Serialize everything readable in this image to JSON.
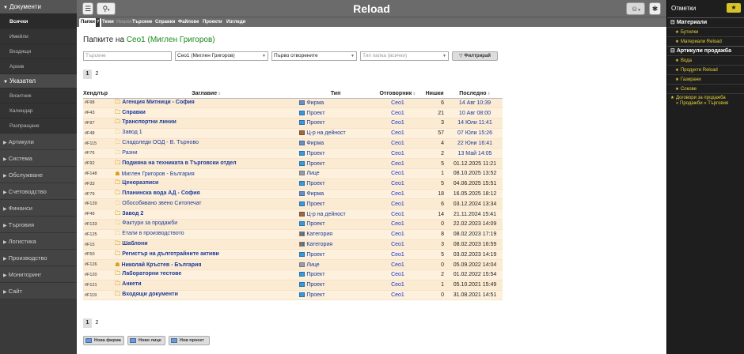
{
  "sidebar": {
    "section_docs": "Документи",
    "docs_items": [
      "Всички",
      "Имейли",
      "Входящи",
      "Архив"
    ],
    "section_index": "Указател",
    "index_items": [
      "Визитник",
      "Календар",
      "Разпращане"
    ],
    "groups": [
      "Артикули",
      "Система",
      "Обслужване",
      "Счетоводство",
      "Финанси",
      "Търговия",
      "Логистика",
      "Производство",
      "Мониторинг",
      "Сайт"
    ]
  },
  "topbar": {
    "title": "Reload"
  },
  "tabs": [
    "Папки",
    "Теми",
    "Нишки",
    "Търсене",
    "Справки",
    "Файлове",
    "Проекти",
    "Изгледи"
  ],
  "tabs_help": "?",
  "heading": {
    "prefix": "Папките на",
    "user": "Сео1 (Миглен Григоров)"
  },
  "filters": {
    "search_placeholder": "Търсене",
    "user_value": "Сео1 (Миглен Григоров)",
    "order_value": "Първо отворените",
    "type_placeholder": "Тип папка (всички)",
    "filter_button": "Филтрирай"
  },
  "pager": {
    "pages": [
      "1",
      "2"
    ],
    "current": "1"
  },
  "columns": {
    "handler": "Хендлър",
    "title": "Заглавие",
    "type": "Тип",
    "responsible": "Отговорник",
    "threads": "Нишки",
    "last": "Последно"
  },
  "rows": [
    {
      "code": "#F98",
      "title": "Агенция Митници - София",
      "type": "Фирма",
      "resp": "Сео1",
      "threads": "6",
      "last": "14 Авг 10:39",
      "bold": true
    },
    {
      "code": "#F43",
      "title": "Справки",
      "type": "Проект",
      "resp": "Сео1",
      "threads": "21",
      "last": "10 Авг 08:00",
      "bold": true
    },
    {
      "code": "#F97",
      "title": "Транспортни линии",
      "type": "Проект",
      "resp": "Сео1",
      "threads": "3",
      "last": "14 Юли 11:41",
      "bold": true
    },
    {
      "code": "#F48",
      "title": "Завод 1",
      "type": "Ц-р на дейност",
      "resp": "Сео1",
      "threads": "57",
      "last": "07 Юли 15:26",
      "bold": false
    },
    {
      "code": "#F115",
      "title": "Сладоледи ООД - В. Търново",
      "type": "Фирма",
      "resp": "Сео1",
      "threads": "4",
      "last": "22 Юни 16:41",
      "bold": false
    },
    {
      "code": "#F76",
      "title": "Разни",
      "type": "Проект",
      "resp": "Сео1",
      "threads": "2",
      "last": "13 Май 14:05",
      "bold": false
    },
    {
      "code": "#F92",
      "title": "Подмяна на техниката в Търговски отдел",
      "type": "Проект",
      "resp": "Сео1",
      "threads": "5",
      "last": "01.12.2025 11:21",
      "bold": true
    },
    {
      "code": "#F148",
      "title": "Миглен Григоров - България",
      "type": "Лице",
      "resp": "Сео1",
      "threads": "1",
      "last": "08.10.2025 13:52",
      "bold": false
    },
    {
      "code": "#F33",
      "title": "Ценоразписи",
      "type": "Проект",
      "resp": "Сео1",
      "threads": "5",
      "last": "04.06.2025 15:51",
      "bold": true
    },
    {
      "code": "#F79",
      "title": "Планинска вода АД - София",
      "type": "Фирма",
      "resp": "Сео1",
      "threads": "18",
      "last": "16.05.2025 18:12",
      "bold": true
    },
    {
      "code": "#F139",
      "title": "Обособявано звено Ситопечат",
      "type": "Проект",
      "resp": "Сео1",
      "threads": "6",
      "last": "03.12.2024 13:34",
      "bold": false
    },
    {
      "code": "#F49",
      "title": "Завод 2",
      "type": "Ц-р на дейност",
      "resp": "Сео1",
      "threads": "14",
      "last": "21.11.2024 15:41",
      "bold": true
    },
    {
      "code": "#F133",
      "title": "Фактури за продажби",
      "type": "Проект",
      "resp": "Сео1",
      "threads": "0",
      "last": "22.02.2023 14:09",
      "bold": false
    },
    {
      "code": "#F125",
      "title": "Етапи в производството",
      "type": "Категория",
      "resp": "Сео1",
      "threads": "8",
      "last": "08.02.2023 17:19",
      "bold": false
    },
    {
      "code": "#F15",
      "title": "Шаблони",
      "type": "Категория",
      "resp": "Сео1",
      "threads": "3",
      "last": "08.02.2023 16:59",
      "bold": true
    },
    {
      "code": "#F50",
      "title": "Регистър на дълготрайните активи",
      "type": "Проект",
      "resp": "Сео1",
      "threads": "5",
      "last": "03.02.2023 14:19",
      "bold": true
    },
    {
      "code": "#F126",
      "title": "Николай Кръстев - България",
      "type": "Лице",
      "resp": "Сео1",
      "threads": "0",
      "last": "05.09.2022 14:04",
      "bold": true
    },
    {
      "code": "#F120",
      "title": "Лабораторни тестове",
      "type": "Проект",
      "resp": "Сео1",
      "threads": "2",
      "last": "01.02.2022 15:54",
      "bold": true
    },
    {
      "code": "#F121",
      "title": "Анкети",
      "type": "Проект",
      "resp": "Сео1",
      "threads": "1",
      "last": "05.10.2021 15:49",
      "bold": true
    },
    {
      "code": "#F119",
      "title": "Входящи документи",
      "type": "Проект",
      "resp": "Сео1",
      "threads": "0",
      "last": "31.08.2021 14:51",
      "bold": true
    }
  ],
  "bottom_buttons": [
    "Нова фирма",
    "Ново лице",
    "Нов проект"
  ],
  "right_panel": {
    "title": "Отметки",
    "sections": [
      {
        "label": "Материали",
        "items": [
          "Бутилки",
          "Материали Reload"
        ]
      },
      {
        "label": "Артикули продажба",
        "items": [
          "Вода",
          "Продукти Reload",
          "Газирани",
          "Сокове"
        ]
      }
    ],
    "extra_line1": "Договори за продажба",
    "extra_line2": "« Продажби « Търговия"
  }
}
